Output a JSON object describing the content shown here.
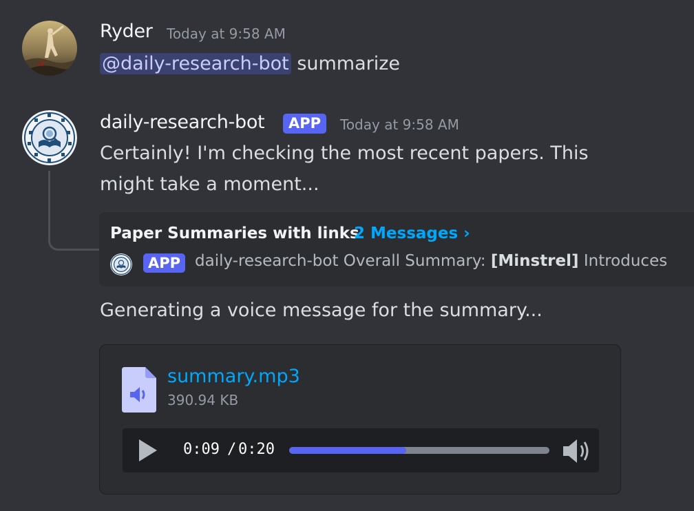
{
  "messages": [
    {
      "author": "Ryder",
      "timestamp": "Today at 9:58 AM",
      "mention": "@daily-research-bot",
      "text": "summarize"
    },
    {
      "author": "daily-research-bot",
      "badge": "APP",
      "timestamp": "Today at 9:58 AM",
      "text_line1": "Certainly! I'm checking the most recent papers. This",
      "text_line2": "might take a moment...",
      "thread": {
        "title": "Paper Summaries with links",
        "count": "2 Messages ›",
        "preview_badge": "APP",
        "preview_author": "daily-research-bot",
        "preview_text_prefix": "Overall Summary: ",
        "preview_bold": "[Minstrel]",
        "preview_text_suffix": " Introduces"
      },
      "followup_text": "Generating a voice message for the summary...",
      "attachment": {
        "file_name": "summary.mp3",
        "file_size": "390.94 KB",
        "current_time": "0:09",
        "separator": "/",
        "duration": "0:20",
        "progress": 0.45
      }
    }
  ],
  "colors": {
    "accent": "#5865f2",
    "link": "#00a8fc",
    "background": "#313338"
  },
  "icons": {
    "file": "audio-file-icon",
    "play": "play-icon",
    "volume": "volume-icon"
  }
}
